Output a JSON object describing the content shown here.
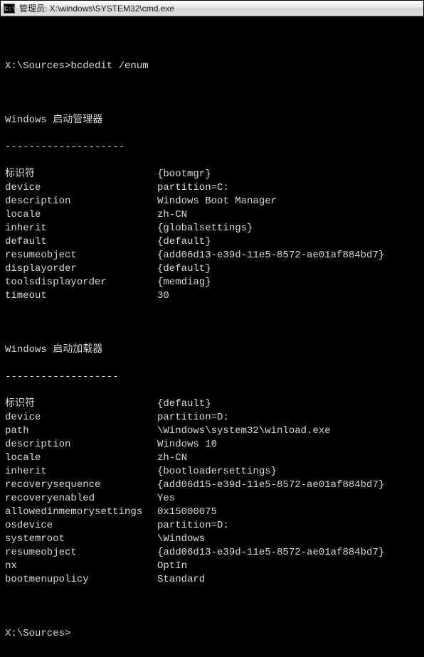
{
  "window": {
    "title": "管理员: X:\\windows\\SYSTEM32\\cmd.exe",
    "icon_glyph": "C:\\"
  },
  "prompt1": {
    "path": "X:\\Sources>",
    "command": "bcdedit /enum"
  },
  "section1": {
    "title": "Windows 启动管理器",
    "dashes": "--------------------",
    "rows": [
      {
        "k": "标识符",
        "v": "{bootmgr}"
      },
      {
        "k": "device",
        "v": "partition=C:"
      },
      {
        "k": "description",
        "v": "Windows Boot Manager"
      },
      {
        "k": "locale",
        "v": "zh-CN"
      },
      {
        "k": "inherit",
        "v": "{globalsettings}"
      },
      {
        "k": "default",
        "v": "{default}"
      },
      {
        "k": "resumeobject",
        "v": "{add06d13-e39d-11e5-8572-ae01af884bd7}"
      },
      {
        "k": "displayorder",
        "v": "{default}"
      },
      {
        "k": "toolsdisplayorder",
        "v": "{memdiag}"
      },
      {
        "k": "timeout",
        "v": "30"
      }
    ]
  },
  "section2": {
    "title": "Windows 启动加载器",
    "dashes": "-------------------",
    "rows": [
      {
        "k": "标识符",
        "v": "{default}"
      },
      {
        "k": "device",
        "v": "partition=D:"
      },
      {
        "k": "path",
        "v": "\\Windows\\system32\\winload.exe"
      },
      {
        "k": "description",
        "v": "Windows 10"
      },
      {
        "k": "locale",
        "v": "zh-CN"
      },
      {
        "k": "inherit",
        "v": "{bootloadersettings}"
      },
      {
        "k": "recoverysequence",
        "v": "{add06d15-e39d-11e5-8572-ae01af884bd7}"
      },
      {
        "k": "recoveryenabled",
        "v": "Yes"
      },
      {
        "k": "allowedinmemorysettings",
        "v": "0x15000075"
      },
      {
        "k": "osdevice",
        "v": "partition=D:"
      },
      {
        "k": "systemroot",
        "v": "\\Windows"
      },
      {
        "k": "resumeobject",
        "v": "{add06d13-e39d-11e5-8572-ae01af884bd7}"
      },
      {
        "k": "nx",
        "v": "OptIn"
      },
      {
        "k": "bootmenupolicy",
        "v": "Standard"
      }
    ]
  },
  "prompt2": {
    "path": "X:\\Sources>"
  }
}
